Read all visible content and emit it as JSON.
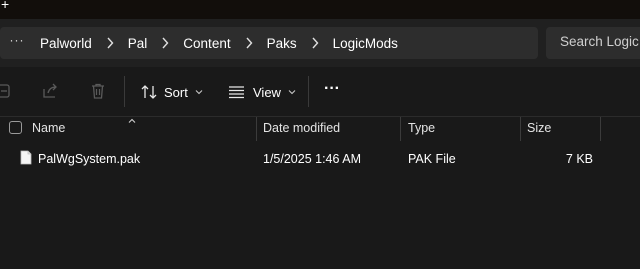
{
  "titlebar": {
    "new_tab_glyph": "+"
  },
  "address": {
    "more_glyph": "···",
    "breadcrumbs": [
      "Palworld",
      "Pal",
      "Content",
      "Paks",
      "LogicMods"
    ]
  },
  "search": {
    "placeholder": "Search Logic"
  },
  "commandbar": {
    "sort_label": "Sort",
    "view_label": "View",
    "more_glyph": "···"
  },
  "columns": {
    "name": "Name",
    "date_modified": "Date modified",
    "type": "Type",
    "size": "Size"
  },
  "files": [
    {
      "name": "PalWgSystem.pak",
      "date_modified": "1/5/2025 1:46 AM",
      "type": "PAK File",
      "size": "7 KB"
    }
  ],
  "colors": {
    "background": "#191919",
    "addressbar": "#2d2d2d",
    "accent_text": "#ffffff"
  }
}
